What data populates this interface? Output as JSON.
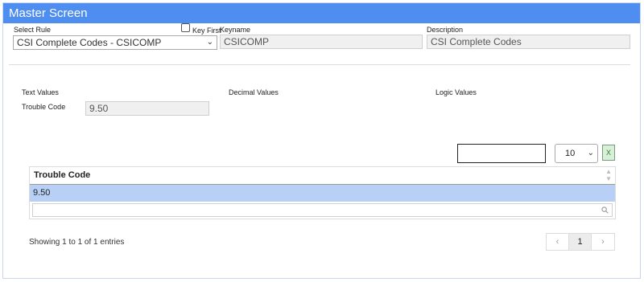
{
  "header": {
    "title": "Master Screen"
  },
  "rule": {
    "label": "Select Rule",
    "selected": "CSI Complete Codes - CSICOMP"
  },
  "key_first": {
    "label": "Key First"
  },
  "keyname": {
    "label": "Keyname",
    "value": "CSICOMP"
  },
  "description": {
    "label": "Description",
    "value": "CSI Complete Codes"
  },
  "sections": {
    "text_values": "Text Values",
    "decimal_values": "Decimal Values",
    "logic_values": "Logic Values"
  },
  "trouble_code": {
    "label": "Trouble Code",
    "value": "9.50"
  },
  "table_controls": {
    "page_length": "10",
    "excel_label": "X"
  },
  "table": {
    "columns": [
      "Trouble Code"
    ],
    "rows": [
      [
        "9.50"
      ]
    ]
  },
  "footer": {
    "info": "Showing 1 to 1 of 1 entries"
  },
  "pagination": {
    "prev": "‹",
    "page": "1",
    "next": "›"
  }
}
